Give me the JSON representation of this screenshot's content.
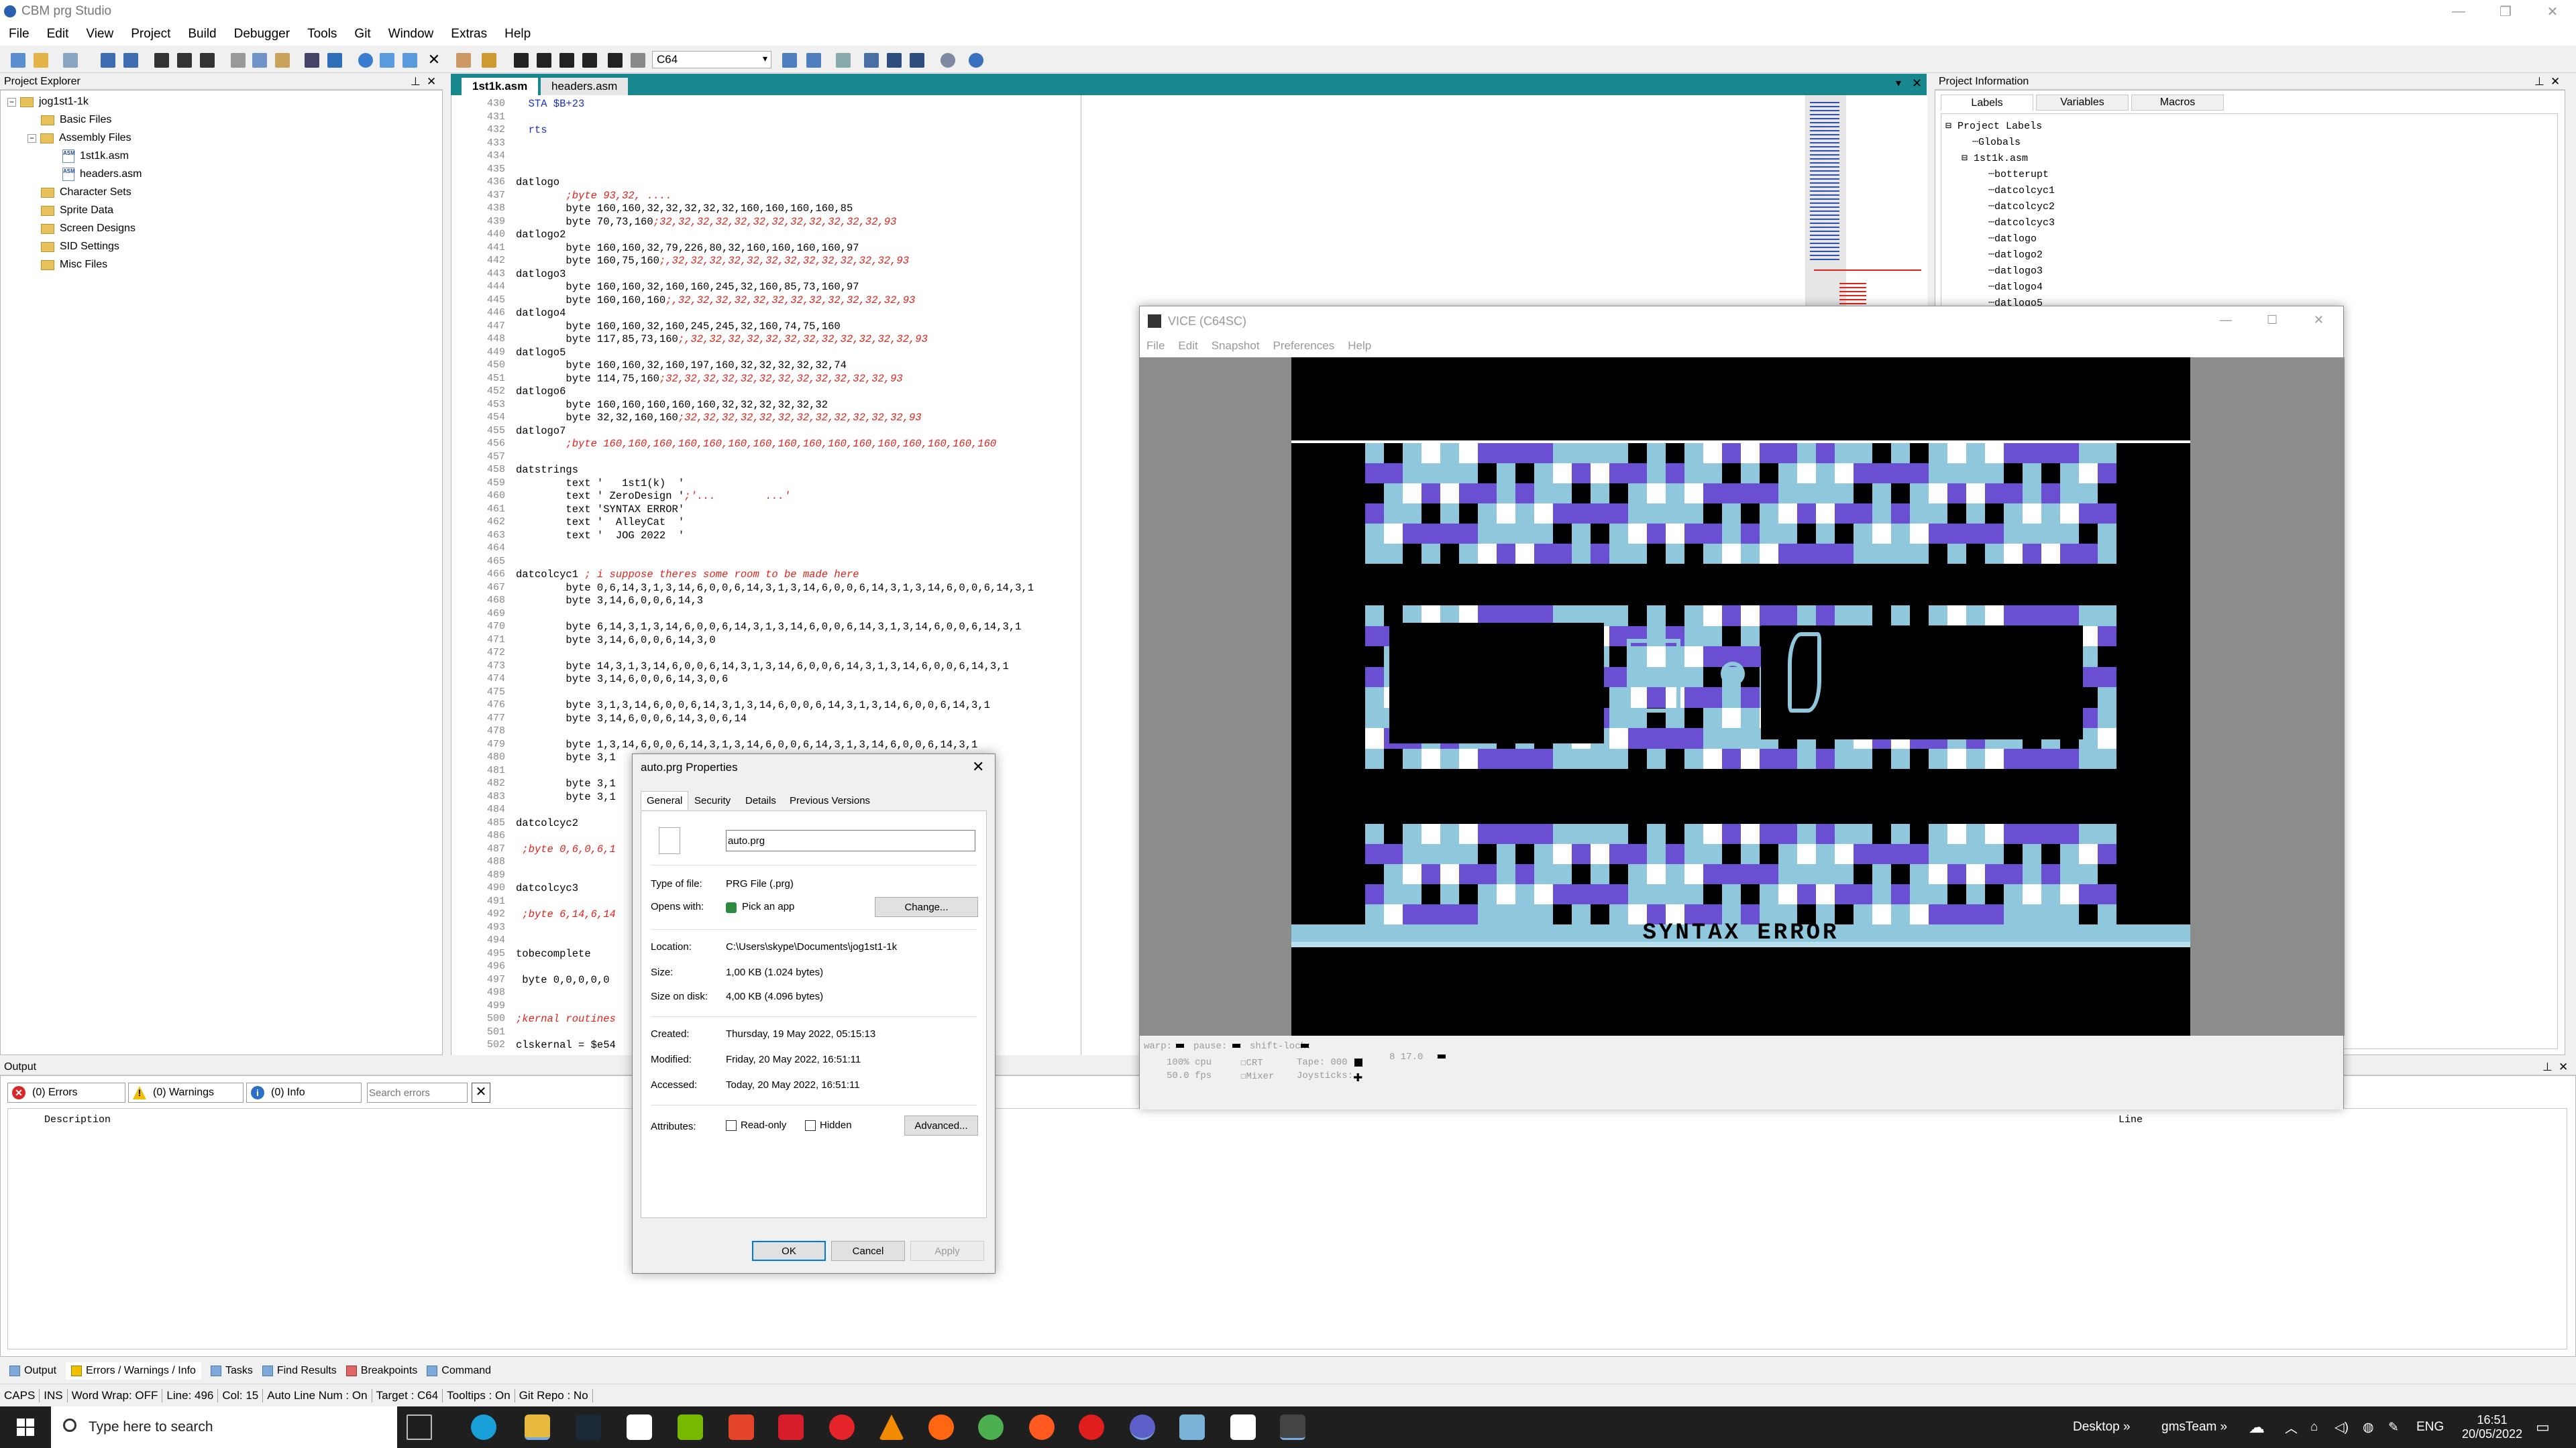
{
  "app": {
    "title": "CBM prg Studio",
    "menu": [
      "File",
      "Edit",
      "View",
      "Project",
      "Build",
      "Debugger",
      "Tools",
      "Git",
      "Window",
      "Extras",
      "Help"
    ],
    "target_select": "C64"
  },
  "project_explorer": {
    "title": "Project Explorer",
    "items": [
      {
        "label": "jog1st1-1k",
        "type": "project"
      },
      {
        "label": "Basic Files",
        "type": "folder"
      },
      {
        "label": "Assembly Files",
        "type": "folder"
      },
      {
        "label": "1st1k.asm",
        "type": "file"
      },
      {
        "label": "headers.asm",
        "type": "file"
      },
      {
        "label": "Character Sets",
        "type": "folder"
      },
      {
        "label": "Sprite Data",
        "type": "folder"
      },
      {
        "label": "Screen Designs",
        "type": "folder"
      },
      {
        "label": "SID Settings",
        "type": "folder"
      },
      {
        "label": "Misc Files",
        "type": "folder"
      }
    ]
  },
  "editor": {
    "tabs": [
      {
        "label": "1st1k.asm",
        "active": true
      },
      {
        "label": "headers.asm",
        "active": false
      }
    ],
    "lines": [
      {
        "n": "430",
        "code": "  STA $B+23",
        "kind": "kw"
      },
      {
        "n": "431",
        "code": "",
        "kind": ""
      },
      {
        "n": "432",
        "code": "  rts",
        "kind": "kw"
      },
      {
        "n": "433",
        "code": "",
        "kind": ""
      },
      {
        "n": "434",
        "code": "",
        "kind": ""
      },
      {
        "n": "435",
        "code": "",
        "kind": ""
      },
      {
        "n": "436",
        "code": "datlogo",
        "kind": ""
      },
      {
        "n": "437",
        "code": "        ;byte 93,32, ....",
        "kind": "cm"
      },
      {
        "n": "438",
        "code": "        byte 160,160,32,32,32,32,32,160,160,160,160,85",
        "kind": ""
      },
      {
        "n": "439",
        "code": "        byte 70,73,160;32,32,32,32,32,32,32,32,32,32,32,32,93",
        "kind": "mix"
      },
      {
        "n": "440",
        "code": "datlogo2",
        "kind": ""
      },
      {
        "n": "441",
        "code": "        byte 160,160,32,79,226,80,32,160,160,160,160,97",
        "kind": ""
      },
      {
        "n": "442",
        "code": "        byte 160,75,160;,32,32,32,32,32,32,32,32,32,32,32,32,93",
        "kind": "mix"
      },
      {
        "n": "443",
        "code": "datlogo3",
        "kind": ""
      },
      {
        "n": "444",
        "code": "        byte 160,160,32,160,160,245,32,160,85,73,160,97",
        "kind": ""
      },
      {
        "n": "445",
        "code": "        byte 160,160,160;,32,32,32,32,32,32,32,32,32,32,32,32,93",
        "kind": "mix"
      },
      {
        "n": "446",
        "code": "datlogo4",
        "kind": ""
      },
      {
        "n": "447",
        "code": "        byte 160,160,32,160,245,245,32,160,74,75,160",
        "kind": ""
      },
      {
        "n": "448",
        "code": "        byte 117,85,73,160;,32,32,32,32,32,32,32,32,32,32,32,32,93",
        "kind": "mix"
      },
      {
        "n": "449",
        "code": "datlogo5",
        "kind": ""
      },
      {
        "n": "450",
        "code": "        byte 160,160,32,160,197,160,32,32,32,32,32,74",
        "kind": ""
      },
      {
        "n": "451",
        "code": "        byte 114,75,160;32,32,32,32,32,32,32,32,32,32,32,32,93",
        "kind": "mix"
      },
      {
        "n": "452",
        "code": "datlogo6",
        "kind": ""
      },
      {
        "n": "453",
        "code": "        byte 160,160,160,160,160,32,32,32,32,32,32",
        "kind": ""
      },
      {
        "n": "454",
        "code": "        byte 32,32,160,160;32,32,32,32,32,32,32,32,32,32,32,32,93",
        "kind": "mix"
      },
      {
        "n": "455",
        "code": "datlogo7",
        "kind": ""
      },
      {
        "n": "456",
        "code": "        ;byte 160,160,160,160,160,160,160,160,160,160,160,160,160,160,160,160",
        "kind": "cm"
      },
      {
        "n": "457",
        "code": "",
        "kind": ""
      },
      {
        "n": "458",
        "code": "datstrings",
        "kind": ""
      },
      {
        "n": "459",
        "code": "        text '   1st1(k)  '",
        "kind": ""
      },
      {
        "n": "460",
        "code": "        text ' ZeroDesign ';'...        ...'",
        "kind": "mix"
      },
      {
        "n": "461",
        "code": "        text 'SYNTAX ERROR'",
        "kind": ""
      },
      {
        "n": "462",
        "code": "        text '  AlleyCat  '",
        "kind": ""
      },
      {
        "n": "463",
        "code": "        text '  JOG 2022  '",
        "kind": ""
      },
      {
        "n": "464",
        "code": "",
        "kind": ""
      },
      {
        "n": "465",
        "code": "",
        "kind": ""
      },
      {
        "n": "466",
        "code": "datcolcyc1 ; i suppose theres some room to be made here",
        "kind": "mix"
      },
      {
        "n": "467",
        "code": "        byte 0,6,14,3,1,3,14,6,0,0,6,14,3,1,3,14,6,0,0,6,14,3,1,3,14,6,0,0,6,14,3,1",
        "kind": ""
      },
      {
        "n": "468",
        "code": "        byte 3,14,6,0,0,6,14,3",
        "kind": ""
      },
      {
        "n": "469",
        "code": "",
        "kind": ""
      },
      {
        "n": "470",
        "code": "        byte 6,14,3,1,3,14,6,0,0,6,14,3,1,3,14,6,0,0,6,14,3,1,3,14,6,0,0,6,14,3,1",
        "kind": ""
      },
      {
        "n": "471",
        "code": "        byte 3,14,6,0,0,6,14,3,0",
        "kind": ""
      },
      {
        "n": "472",
        "code": "",
        "kind": ""
      },
      {
        "n": "473",
        "code": "        byte 14,3,1,3,14,6,0,0,6,14,3,1,3,14,6,0,0,6,14,3,1,3,14,6,0,0,6,14,3,1",
        "kind": ""
      },
      {
        "n": "474",
        "code": "        byte 3,14,6,0,0,6,14,3,0,6",
        "kind": ""
      },
      {
        "n": "475",
        "code": "",
        "kind": ""
      },
      {
        "n": "476",
        "code": "        byte 3,1,3,14,6,0,0,6,14,3,1,3,14,6,0,0,6,14,3,1,3,14,6,0,0,6,14,3,1",
        "kind": ""
      },
      {
        "n": "477",
        "code": "        byte 3,14,6,0,0,6,14,3,0,6,14",
        "kind": ""
      },
      {
        "n": "478",
        "code": "",
        "kind": ""
      },
      {
        "n": "479",
        "code": "        byte 1,3,14,6,0,0,6,14,3,1,3,14,6,0,0,6,14,3,1,3,14,6,0,0,6,14,3,1",
        "kind": ""
      },
      {
        "n": "480",
        "code": "        byte 3,1",
        "kind": ""
      },
      {
        "n": "481",
        "code": "",
        "kind": ""
      },
      {
        "n": "482",
        "code": "        byte 3,1                                                       ,3,1",
        "kind": ""
      },
      {
        "n": "483",
        "code": "        byte 3,1",
        "kind": ""
      },
      {
        "n": "484",
        "code": "",
        "kind": ""
      },
      {
        "n": "485",
        "code": "datcolcyc2",
        "kind": ""
      },
      {
        "n": "486",
        "code": "",
        "kind": ""
      },
      {
        "n": "487",
        "code": " ;byte 0,6,0,6,1",
        "kind": "cm"
      },
      {
        "n": "488",
        "code": "",
        "kind": ""
      },
      {
        "n": "489",
        "code": "",
        "kind": ""
      },
      {
        "n": "490",
        "code": "datcolcyc3",
        "kind": ""
      },
      {
        "n": "491",
        "code": "",
        "kind": ""
      },
      {
        "n": "492",
        "code": " ;byte 6,14,6,14",
        "kind": "cm"
      },
      {
        "n": "493",
        "code": "",
        "kind": ""
      },
      {
        "n": "494",
        "code": "",
        "kind": ""
      },
      {
        "n": "495",
        "code": "tobecomplete",
        "kind": ""
      },
      {
        "n": "496",
        "code": "",
        "kind": ""
      },
      {
        "n": "497",
        "code": " byte 0,0,0,0,0",
        "kind": ""
      },
      {
        "n": "498",
        "code": "",
        "kind": ""
      },
      {
        "n": "499",
        "code": "",
        "kind": ""
      },
      {
        "n": "500",
        "code": ";kernal routines",
        "kind": "cm"
      },
      {
        "n": "501",
        "code": "",
        "kind": ""
      },
      {
        "n": "502",
        "code": "clskernal = $e54",
        "kind": ""
      }
    ]
  },
  "project_info": {
    "title": "Project Information",
    "tabs": [
      "Labels",
      "Variables",
      "Macros"
    ],
    "labels": [
      {
        "text": "Project Labels",
        "level": 0
      },
      {
        "text": "Globals",
        "level": 1
      },
      {
        "text": "1st1k.asm",
        "level": 1
      },
      {
        "text": "botterupt",
        "level": 2
      },
      {
        "text": "datcolcyc1",
        "level": 2
      },
      {
        "text": "datcolcyc2",
        "level": 2
      },
      {
        "text": "datcolcyc3",
        "level": 2
      },
      {
        "text": "datlogo",
        "level": 2
      },
      {
        "text": "datlogo2",
        "level": 2
      },
      {
        "text": "datlogo3",
        "level": 2
      },
      {
        "text": "datlogo4",
        "level": 2
      },
      {
        "text": "datlogo5",
        "level": 2
      }
    ]
  },
  "output": {
    "title": "Output",
    "errors": "(0) Errors",
    "warnings": "(0) Warnings",
    "info": "(0) Info",
    "search_placeholder": "Search errors",
    "col_description": "Description",
    "col_line": "Line"
  },
  "bottom_tabs": [
    "Output",
    "Errors / Warnings / Info",
    "Tasks",
    "Find Results",
    "Breakpoints",
    "Command"
  ],
  "statusbar": [
    "CAPS",
    "INS",
    "Word Wrap: OFF",
    "Line: 496",
    "Col: 15",
    "Auto Line Num : On",
    "Target : C64",
    "Tooltips : On",
    "Git Repo : No"
  ],
  "vice": {
    "title": "VICE (C64SC)",
    "menu": [
      "File",
      "Edit",
      "Snapshot",
      "Preferences",
      "Help"
    ],
    "screen_text": "SYNTAX ERROR",
    "status": {
      "warp": "warp:",
      "pause": "pause:",
      "shiftlock": "shift-lock:",
      "cpu": "100% cpu",
      "fps": "50.0 fps",
      "crt": "CRT",
      "mixer": "Mixer",
      "tape": "Tape: 000",
      "joysticks": "Joysticks:",
      "drive": "8 17.0"
    },
    "palette": {
      "light_blue": "#8fc7dc",
      "purple": "#6a4fd2",
      "white": "#ffffff",
      "black": "#000000"
    }
  },
  "props": {
    "title": "auto.prg Properties",
    "tabs": [
      "General",
      "Security",
      "Details",
      "Previous Versions"
    ],
    "filename": "auto.prg",
    "rows": [
      {
        "label": "Type of file:",
        "value": "PRG File (.prg)"
      },
      {
        "label": "Opens with:",
        "value": "Pick an app"
      },
      {
        "label": "Location:",
        "value": "C:\\Users\\skype\\Documents\\jog1st1-1k"
      },
      {
        "label": "Size:",
        "value": "1,00 KB (1.024 bytes)"
      },
      {
        "label": "Size on disk:",
        "value": "4,00 KB (4.096 bytes)"
      },
      {
        "label": "Created:",
        "value": "Thursday, 19 May 2022, 05:15:13"
      },
      {
        "label": "Modified:",
        "value": "Friday, 20 May 2022, 16:51:11"
      },
      {
        "label": "Accessed:",
        "value": "Today, 20 May 2022, 16:51:11"
      }
    ],
    "change_btn": "Change...",
    "attributes_label": "Attributes:",
    "readonly": "Read-only",
    "hidden": "Hidden",
    "advanced_btn": "Advanced...",
    "ok": "OK",
    "cancel": "Cancel",
    "apply": "Apply"
  },
  "taskbar": {
    "search_placeholder": "Type here to search",
    "desktop": "Desktop",
    "user": "gmsTeam",
    "lang": "ENG",
    "time": "16:51",
    "date": "20/05/2022"
  }
}
